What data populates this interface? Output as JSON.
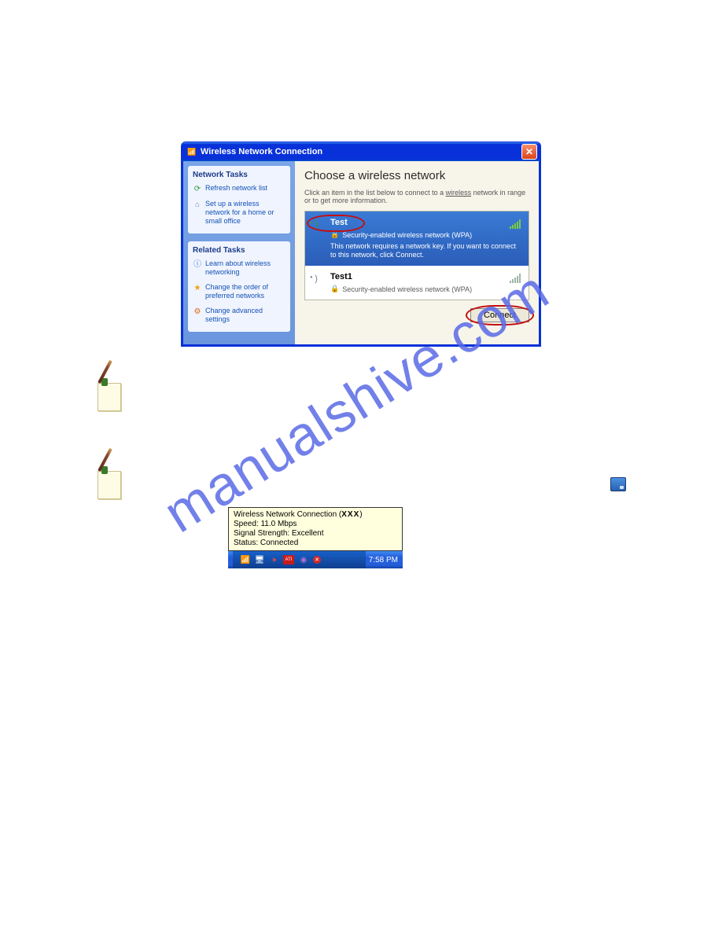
{
  "dialog": {
    "title": "Wireless Network Connection",
    "sidebar": {
      "tasks_title": "Network Tasks",
      "refresh": "Refresh network list",
      "setup": "Set up a wireless network for a home or small office",
      "related_title": "Related Tasks",
      "learn": "Learn about wireless networking",
      "order": "Change the order of preferred networks",
      "advanced": "Change advanced settings"
    },
    "main": {
      "heading": "Choose a wireless network",
      "desc_pre": "Click an item in the list below to connect to a ",
      "desc_link": "wireless",
      "desc_post": " network in range or to get more information.",
      "networks": [
        {
          "name": "Test",
          "sub": "Security-enabled wireless network (WPA)",
          "extra": "This network requires a network key. If you want to connect to this network, click Connect."
        },
        {
          "name": "Test1",
          "sub": "Security-enabled wireless network (WPA)"
        }
      ],
      "connect_label": "Connect"
    }
  },
  "balloon": {
    "title_pre": "Wireless Network Connection (",
    "title_mid": "XXX",
    "title_post": ")",
    "speed": "Speed: 11.0 Mbps",
    "signal": "Signal Strength: Excellent",
    "status": "Status:  Connected"
  },
  "taskbar": {
    "time": "7:58 PM",
    "ati": "ATI"
  },
  "watermark": "manualshive.com"
}
